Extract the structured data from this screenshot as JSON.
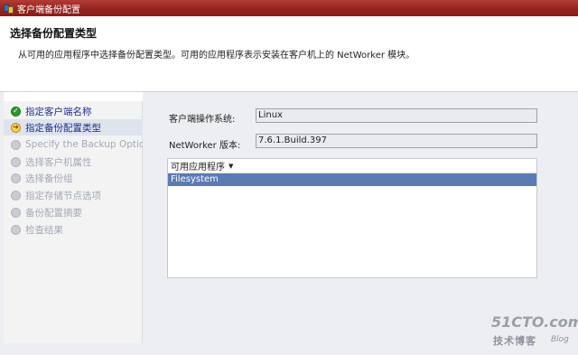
{
  "window": {
    "title": "客户端备份配置"
  },
  "header": {
    "title": "选择备份配置类型",
    "description": "从可用的应用程序中选择备份配置类型。可用的应用程序表示安装在客户机上的 NetWorker 模块。"
  },
  "nav": {
    "items": [
      {
        "label": "指定客户端名称",
        "state": "done",
        "icon": "check-icon"
      },
      {
        "label": "指定备份配置类型",
        "state": "current",
        "icon": "arrow-icon"
      },
      {
        "label": "Specify the Backup Options",
        "state": "pending",
        "icon": "dot-icon"
      },
      {
        "label": "选择客户机属性",
        "state": "pending",
        "icon": "dot-icon"
      },
      {
        "label": "选择备份组",
        "state": "pending",
        "icon": "dot-icon"
      },
      {
        "label": "指定存储节点选项",
        "state": "pending",
        "icon": "dot-icon"
      },
      {
        "label": "备份配置摘要",
        "state": "pending",
        "icon": "dot-icon"
      },
      {
        "label": "检查结果",
        "state": "pending",
        "icon": "dot-icon"
      }
    ]
  },
  "form": {
    "os_label": "客户端操作系统:",
    "os_value": "Linux",
    "version_label": "NetWorker 版本:",
    "version_value": "7.6.1.Build.397"
  },
  "app_list": {
    "header": "可用应用程序",
    "rows": [
      "Filesystem"
    ],
    "selected_index": 0
  },
  "watermark": {
    "main": "51CTO.com",
    "sub": "技术博客",
    "blog": "Blog"
  },
  "colors": {
    "titlebar": "#96231f",
    "nav_selected": "#dde4ee",
    "list_selected": "#5b7bb3",
    "done_icon": "#2b9b2b",
    "current_icon": "#f6d04c"
  }
}
